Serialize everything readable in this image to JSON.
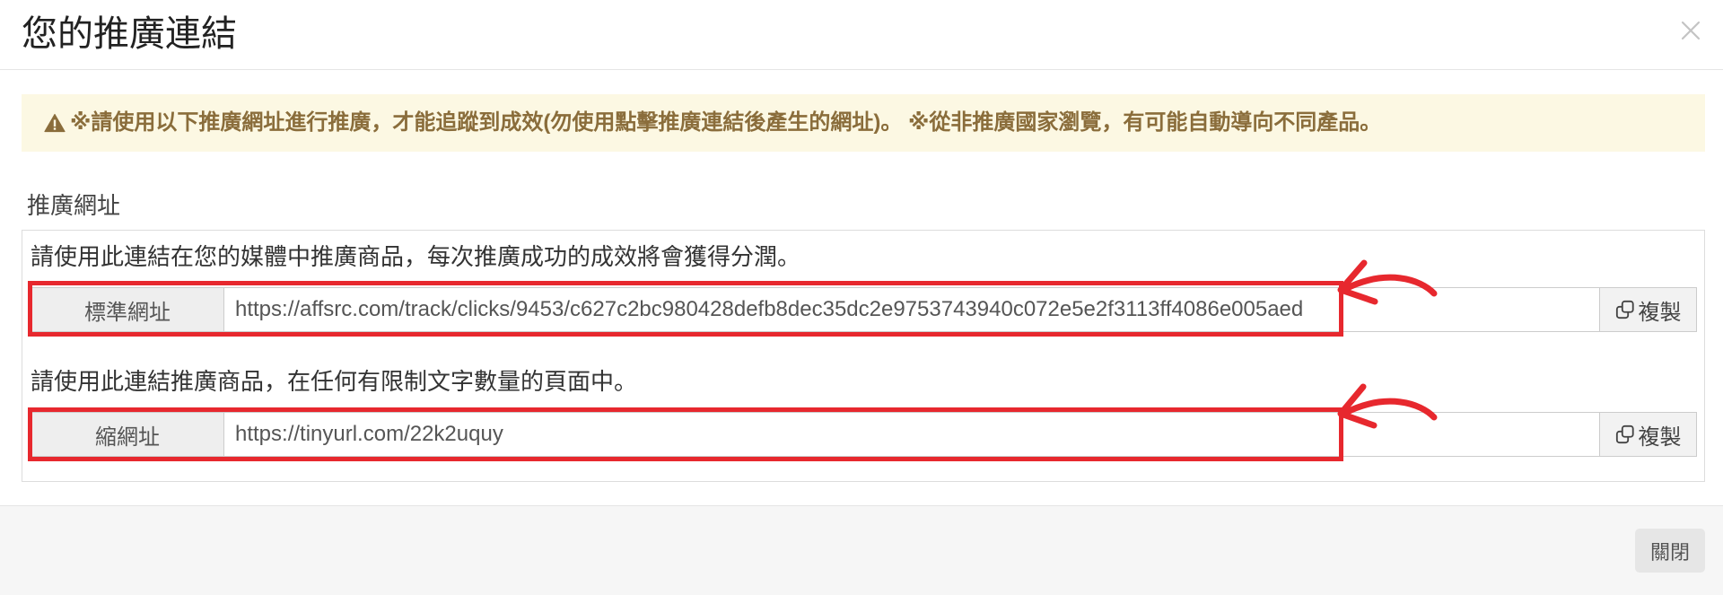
{
  "modal": {
    "title": "您的推廣連結",
    "close_icon": "close-icon"
  },
  "alert": {
    "icon": "warning-icon",
    "text": "※請使用以下推廣網址進行推廣，才能追蹤到成效(勿使用點擊推廣連結後產生的網址)。 ※從非推廣國家瀏覽，有可能自動導向不同產品。"
  },
  "section": {
    "label": "推廣網址",
    "groups": [
      {
        "description": "請使用此連結在您的媒體中推廣商品，每次推廣成功的成效將會獲得分潤。",
        "addon": "標準網址",
        "url": "https://affsrc.com/track/clicks/9453/c627c2bc980428defb8dec35dc2e9753743940c072e5e2f3113ff4086e005aed",
        "copy_icon": "copy-icon",
        "copy_label": "複製"
      },
      {
        "description": "請使用此連結推廣商品，在任何有限制文字數量的頁面中。",
        "addon": "縮網址",
        "url": "https://tinyurl.com/22k2uquy",
        "copy_icon": "copy-icon",
        "copy_label": "複製"
      }
    ]
  },
  "footer": {
    "close_label": "關閉"
  },
  "colors": {
    "alert_background": "#fcf8e3",
    "alert_text": "#8a6d3b",
    "annotation": "#e7282e"
  }
}
